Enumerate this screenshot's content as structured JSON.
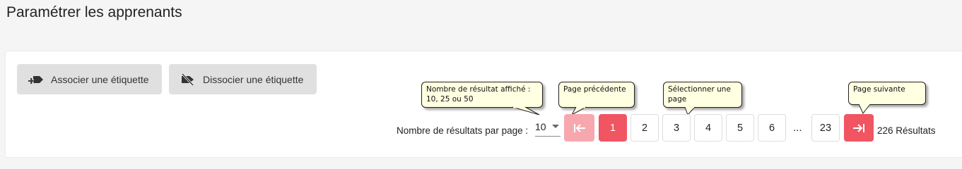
{
  "page": {
    "title": "Paramétrer les apprenants"
  },
  "actions": {
    "associate_label": "Associer une étiquette",
    "dissociate_label": "Dissocier une étiquette",
    "associate_icon": "tag-add-icon",
    "dissociate_icon": "tag-off-icon"
  },
  "tooltips": {
    "results_per_page": "Nombre de résultat affiché : 10, 25 ou 50",
    "previous_page": "Page précédente",
    "select_page": "Sélectionner une page",
    "next_page": "Page suivante"
  },
  "pagination": {
    "per_page_label": "Nombre de résultats par page :",
    "per_page_value": "10",
    "first_icon": "first-page-icon",
    "last_icon": "last-page-icon",
    "pages": [
      "1",
      "2",
      "3",
      "4",
      "5",
      "6"
    ],
    "current_page": "1",
    "ellipsis": "...",
    "last_page": "23",
    "results_text": "226 Résultats"
  },
  "colors": {
    "accent": "#f05561",
    "accent_disabled": "#f7a8ae",
    "tooltip_bg": "#ffffe1",
    "button_bg": "#e0e0e0"
  }
}
